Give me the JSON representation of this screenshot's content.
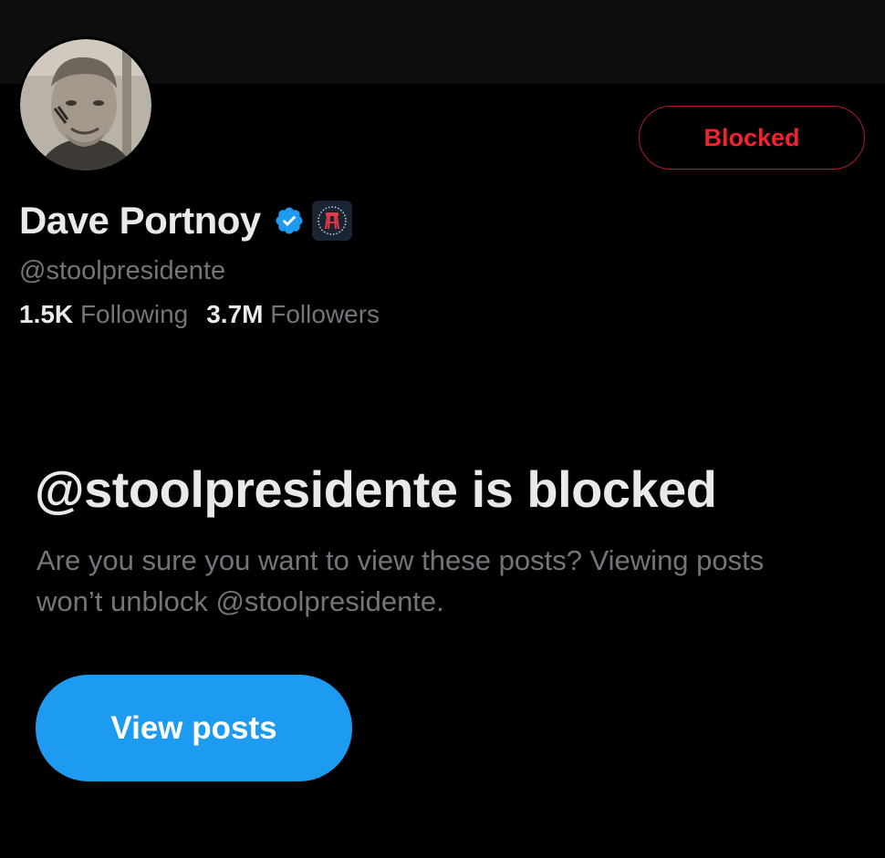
{
  "profile": {
    "display_name": "Dave Portnoy",
    "handle": "@stoolpresidente",
    "following_count": "1.5K",
    "following_label": "Following",
    "followers_count": "3.7M",
    "followers_label": "Followers",
    "verified_icon": "verified-badge-icon",
    "affiliate_icon": "barstool-affiliate-icon"
  },
  "actions": {
    "blocked_label": "Blocked",
    "view_posts_label": "View posts"
  },
  "blocked_notice": {
    "title": "@stoolpresidente is blocked",
    "description": "Are you sure you want to view these posts? Viewing posts won’t unblock @stoolpresidente."
  },
  "colors": {
    "background": "#000000",
    "blocked_red": "#f4212e",
    "accent_blue": "#1d9bf0",
    "secondary_text": "#71767b",
    "primary_text": "#e7e9ea"
  }
}
